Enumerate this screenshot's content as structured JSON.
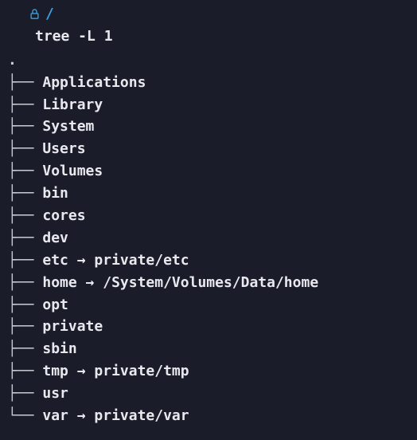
{
  "prompt": {
    "path": "/"
  },
  "command": "tree -L 1",
  "tree": {
    "root": ".",
    "branch_mid": "├── ",
    "branch_last": "└── ",
    "arrow": " → ",
    "items": [
      {
        "name": "Applications",
        "link": null,
        "last": false
      },
      {
        "name": "Library",
        "link": null,
        "last": false
      },
      {
        "name": "System",
        "link": null,
        "last": false
      },
      {
        "name": "Users",
        "link": null,
        "last": false
      },
      {
        "name": "Volumes",
        "link": null,
        "last": false
      },
      {
        "name": "bin",
        "link": null,
        "last": false
      },
      {
        "name": "cores",
        "link": null,
        "last": false
      },
      {
        "name": "dev",
        "link": null,
        "last": false
      },
      {
        "name": "etc",
        "link": "private/etc",
        "last": false
      },
      {
        "name": "home",
        "link": "/System/Volumes/Data/home",
        "last": false
      },
      {
        "name": "opt",
        "link": null,
        "last": false
      },
      {
        "name": "private",
        "link": null,
        "last": false
      },
      {
        "name": "sbin",
        "link": null,
        "last": false
      },
      {
        "name": "tmp",
        "link": "private/tmp",
        "last": false
      },
      {
        "name": "usr",
        "link": null,
        "last": false
      },
      {
        "name": "var",
        "link": "private/var",
        "last": true
      }
    ]
  }
}
